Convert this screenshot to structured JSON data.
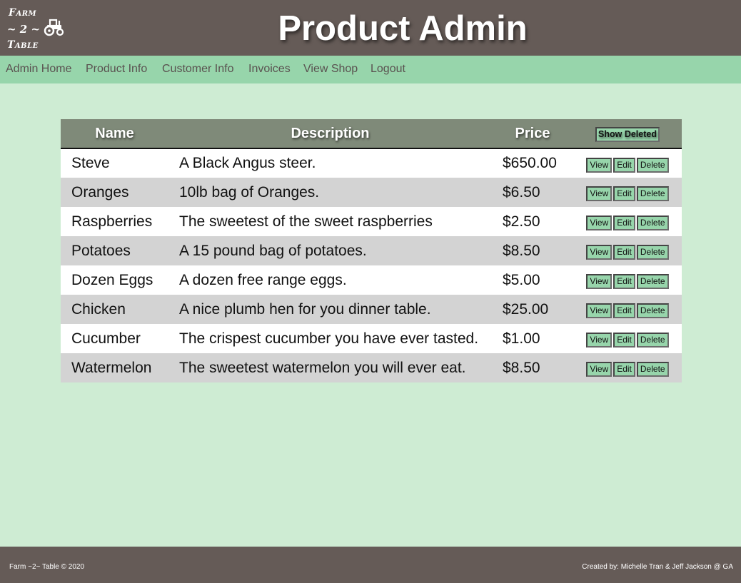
{
  "logo": {
    "line1": "Farm",
    "line2": "~ 2 ~",
    "line3": "Table"
  },
  "header": {
    "title": "Product Admin"
  },
  "nav": [
    "Admin Home",
    "Product Info",
    "Customer Info",
    "Invoices",
    "View Shop",
    "Logout"
  ],
  "table": {
    "columns": {
      "name": "Name",
      "description": "Description",
      "price": "Price",
      "show_deleted": "Show Deleted"
    },
    "action_labels": {
      "view": "View",
      "edit": "Edit",
      "delete": "Delete"
    },
    "rows": [
      {
        "name": "Steve",
        "description": "A Black Angus steer.",
        "price": "$650.00"
      },
      {
        "name": "Oranges",
        "description": "10lb bag of Oranges.",
        "price": "$6.50"
      },
      {
        "name": "Raspberries",
        "description": "The sweetest of the sweet raspberries",
        "price": "$2.50"
      },
      {
        "name": "Potatoes",
        "description": "A 15 pound bag of potatoes.",
        "price": "$8.50"
      },
      {
        "name": "Dozen Eggs",
        "description": "A dozen free range eggs.",
        "price": "$5.00"
      },
      {
        "name": "Chicken",
        "description": "A nice plumb hen for you dinner table.",
        "price": "$25.00"
      },
      {
        "name": "Cucumber",
        "description": "The crispest cucumber you have ever tasted.",
        "price": "$1.00"
      },
      {
        "name": "Watermelon",
        "description": "The sweetest watermelon you will ever eat.",
        "price": "$8.50"
      }
    ]
  },
  "footer": {
    "left": "Farm ~2~ Table © 2020",
    "right": "Created by: Michelle Tran & Jeff Jackson @ GA"
  },
  "colors": {
    "header_bg": "#655b57",
    "nav_bg": "#97d5ab",
    "page_bg": "#ceecd3",
    "table_head_bg": "#7f8a79",
    "button_bg": "#97d5ab"
  }
}
